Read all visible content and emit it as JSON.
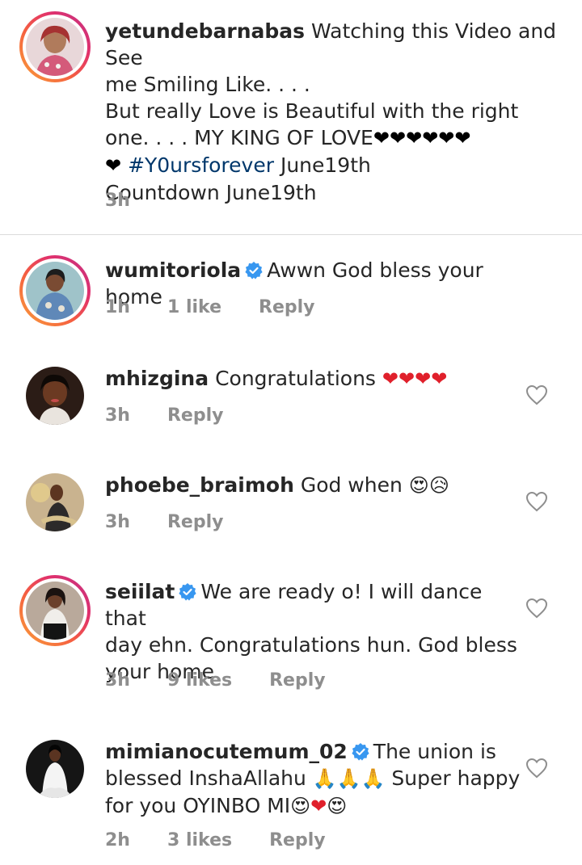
{
  "caption": {
    "username": "yetundebarnabas",
    "text_line1": "Watching this Video and See",
    "text_line2": "me Smiling Like. . . .",
    "text_line3": "But really Love is Beautiful with the right",
    "text_line4": "one. . . . MY KING OF LOVE",
    "hashtag": "#Y0ursforever",
    "text_after_hashtag": "June19th",
    "text_line6": "Countdown June19th",
    "time": "3h"
  },
  "comments": [
    {
      "username": "wumitoriola",
      "verified": true,
      "text": "Awwn God bless your home",
      "time": "1h",
      "likes": "1 like",
      "reply": "Reply"
    },
    {
      "username": "mhizgina",
      "verified": false,
      "text": "Congratulations",
      "time": "3h",
      "reply": "Reply"
    },
    {
      "username": "phoebe_braimoh",
      "verified": false,
      "text": "God when",
      "time": "3h",
      "reply": "Reply"
    },
    {
      "username": "seiilat",
      "verified": true,
      "text_line1": "We are ready o! I will dance that",
      "text_line2": "day ehn. Congratulations hun. God bless",
      "text_line3": "your home",
      "time": "3h",
      "likes": "9 likes",
      "reply": "Reply"
    },
    {
      "username": "mimianocutemum_02",
      "verified": true,
      "text_line1": "The union is",
      "text_line2": "blessed InshaAllahu",
      "text_line2b": "Super happy",
      "text_line3": "for you OYINBO MI",
      "time": "2h",
      "likes": "3 likes",
      "reply": "Reply"
    }
  ],
  "colors": {
    "verified_blue": "#3897f0",
    "hashtag": "#00376b",
    "meta_gray": "#8e8e8e"
  },
  "icons": [
    "black-heart-emoji",
    "red-heart-emoji",
    "heart-eyes-emoji",
    "sad-tear-emoji",
    "folded-hands-emoji",
    "verified-badge-icon",
    "like-heart-icon"
  ]
}
